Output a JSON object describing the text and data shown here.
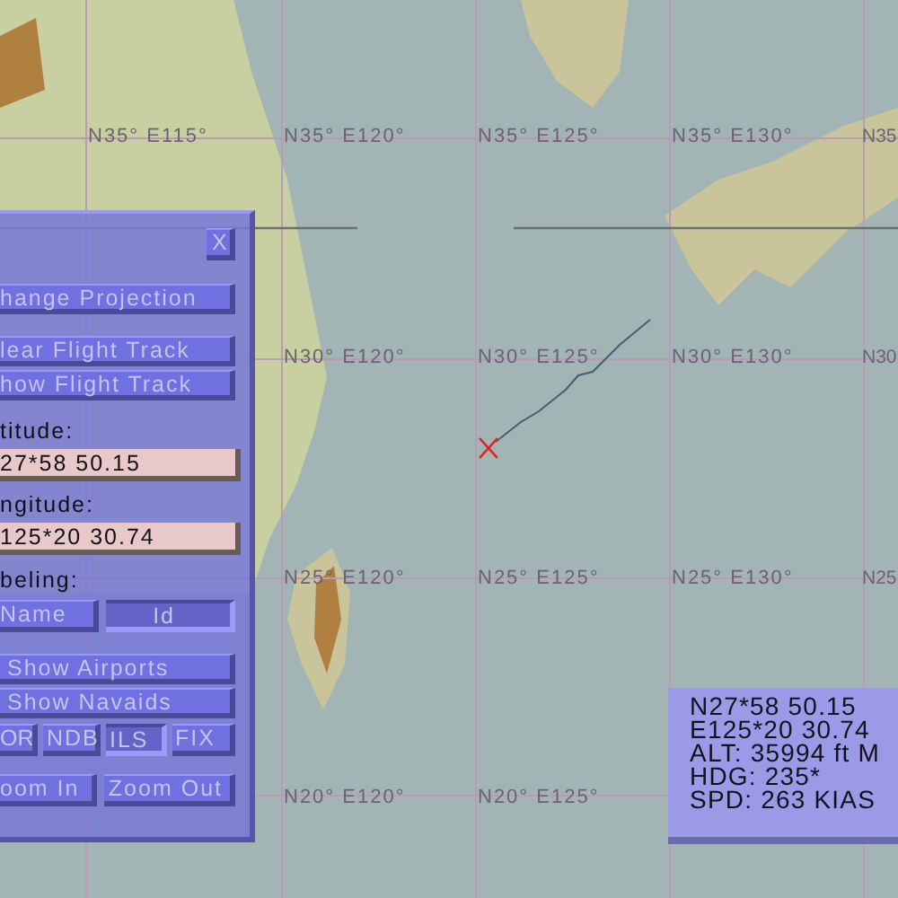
{
  "map": {
    "grid_labels": [
      {
        "text": "N35° E115°"
      },
      {
        "text": "N35° E120°"
      },
      {
        "text": "N35° E125°"
      },
      {
        "text": "N35° E130°"
      },
      {
        "text": "N35"
      },
      {
        "text": "N30° E120°"
      },
      {
        "text": "N30° E125°"
      },
      {
        "text": "N30° E130°"
      },
      {
        "text": "N30"
      },
      {
        "text": "N25° E120°"
      },
      {
        "text": "N25° E125°"
      },
      {
        "text": "N25° E130°"
      },
      {
        "text": "N25"
      },
      {
        "text": "N20° E120°"
      },
      {
        "text": "N20° E125°"
      }
    ]
  },
  "control_panel": {
    "close": "X",
    "buttons": [
      {
        "label": "hange Projection"
      },
      {
        "label": "lear Flight Track"
      },
      {
        "label": "how Flight Track"
      }
    ],
    "latitude": {
      "label": "titude:",
      "value": "27*58 50.15"
    },
    "longitude": {
      "label": "ngitude:",
      "value": "125*20 30.74"
    },
    "labeling": {
      "label": "beling:",
      "options": [
        {
          "label": "Name",
          "selected": false
        },
        {
          "label": "Id",
          "selected": true
        }
      ]
    },
    "show_buttons": [
      {
        "label": "Show Airports"
      },
      {
        "label": "Show Navaids"
      }
    ],
    "navaid_filters": [
      {
        "label": "OR",
        "on": false
      },
      {
        "label": "NDB",
        "on": false
      },
      {
        "label": "ILS",
        "on": true
      },
      {
        "label": "FIX",
        "on": false
      }
    ],
    "zoom_buttons": [
      {
        "label": "oom In"
      },
      {
        "label": "Zoom Out"
      }
    ]
  },
  "info_box": {
    "lines": [
      "N27*58 50.15",
      "E125*20 30.74",
      "ALT: 35994 ft M",
      "HDG: 235*",
      "SPD: 263 KIAS"
    ]
  }
}
